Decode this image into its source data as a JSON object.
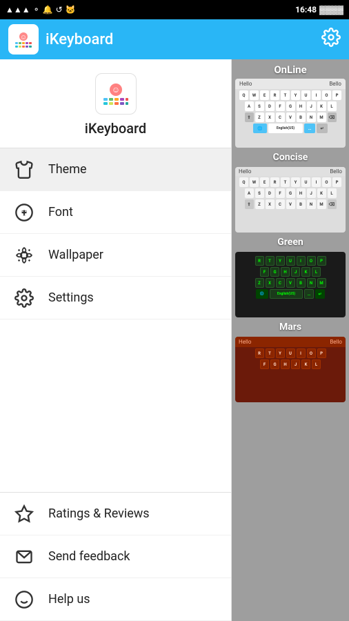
{
  "statusBar": {
    "time": "16:48",
    "battery": "████"
  },
  "header": {
    "appName": "iKeyboard",
    "settingsLabel": "Settings"
  },
  "sidebar": {
    "brandName": "iKeyboard",
    "menuItems": [
      {
        "id": "theme",
        "label": "Theme",
        "icon": "shirt"
      },
      {
        "id": "font",
        "label": "Font",
        "icon": "font"
      },
      {
        "id": "wallpaper",
        "label": "Wallpaper",
        "icon": "flower"
      },
      {
        "id": "settings",
        "label": "Settings",
        "icon": "gear"
      }
    ],
    "bottomItems": [
      {
        "id": "ratings",
        "label": "Ratings & Reviews",
        "icon": "star"
      },
      {
        "id": "feedback",
        "label": "Send feedback",
        "icon": "message"
      },
      {
        "id": "help",
        "label": "Help us",
        "icon": "smiley"
      }
    ]
  },
  "rightPanel": {
    "themes": [
      {
        "id": "online",
        "label": "OnLine"
      },
      {
        "id": "concise",
        "label": "Concise"
      },
      {
        "id": "green",
        "label": "Green"
      },
      {
        "id": "mars",
        "label": "Mars"
      }
    ]
  }
}
